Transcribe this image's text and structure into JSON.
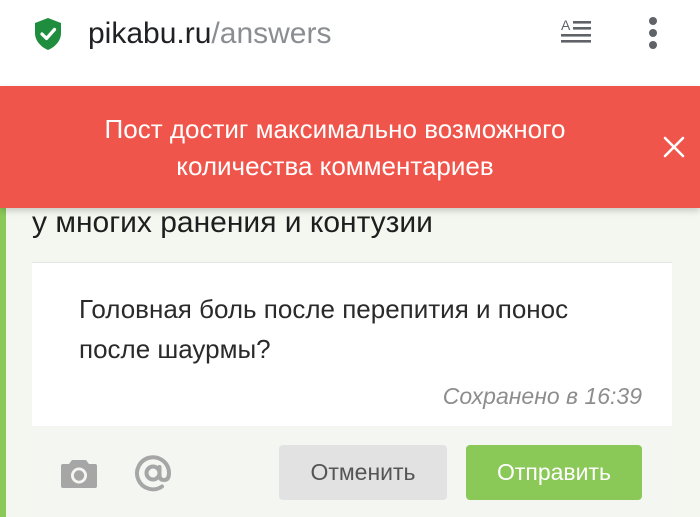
{
  "browser": {
    "url_host": "pikabu.ru",
    "url_path": "/answers",
    "icons": [
      "shield-check-icon",
      "reader-mode-icon",
      "more-vert-icon"
    ]
  },
  "banner": {
    "line1": "Пост достиг максимально возможного",
    "line2": "количества комментариев",
    "close_icon": "close-icon",
    "color": "#f0554b"
  },
  "post": {
    "heading": "у многих ранения и контузии"
  },
  "comment_form": {
    "text_line1": "Головная боль после перепития и понос",
    "text_line2": "после шаурмы?",
    "saved_status": "Сохранено в 16:39",
    "camera_icon": "camera-icon",
    "mention_icon": "at-sign-icon",
    "cancel_label": "Отменить",
    "send_label": "Отправить",
    "accent_color": "#8ac858"
  }
}
